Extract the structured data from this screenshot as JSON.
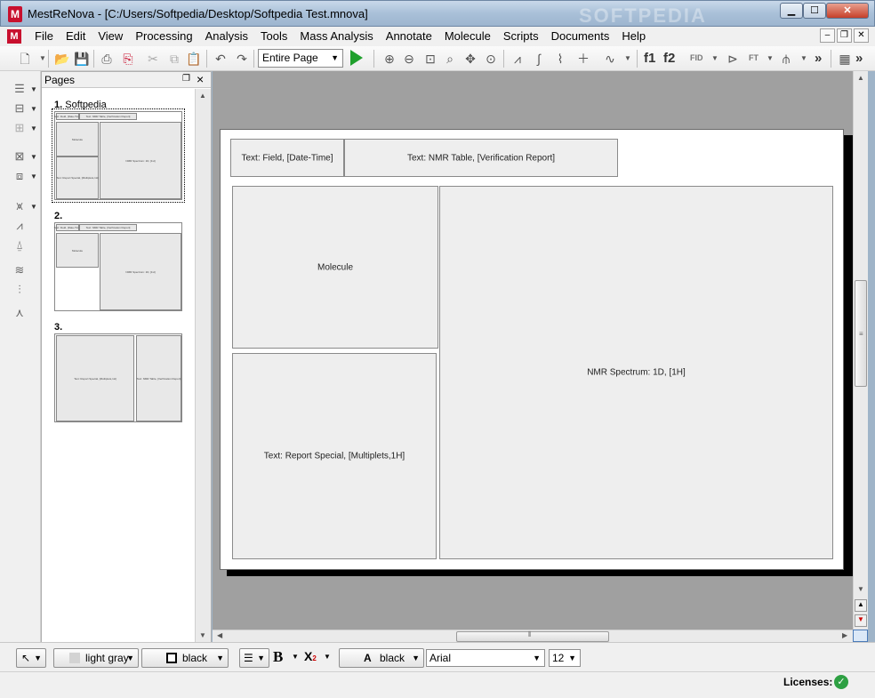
{
  "window": {
    "app_name": "MestReNova",
    "title": "MestReNova - [C:/Users/Softpedia/Desktop/Softpedia Test.mnova]",
    "watermark": "SOFTPEDIA"
  },
  "menu": {
    "items": [
      "File",
      "Edit",
      "View",
      "Processing",
      "Analysis",
      "Tools",
      "Mass Analysis",
      "Annotate",
      "Molecule",
      "Scripts",
      "Documents",
      "Help"
    ]
  },
  "toolbar": {
    "page_view_value": "Entire Page",
    "f1_label": "f1",
    "f2_label": "f2",
    "fid_label": "FID",
    "ft_label": "FT",
    "overflow_label": "»"
  },
  "pages_panel": {
    "header": "Pages",
    "pages": [
      {
        "number": "1.",
        "name": "Softpedia"
      },
      {
        "number": "2.",
        "name": ""
      },
      {
        "number": "3.",
        "name": ""
      }
    ]
  },
  "document": {
    "frames": {
      "datetime": "Text: Field, [Date-Time]",
      "nmr_table": "Text: NMR Table, [Verification Report]",
      "molecule": "Molecule",
      "report_special": "Text: Report Special, [Multiplets,1H]",
      "nmr_spectrum": "NMR Spectrum: 1D, [1H]"
    }
  },
  "format_bar": {
    "fill_color": "light gray",
    "line_color": "black",
    "bold_label": "B",
    "subscript_label": "X",
    "subscript_index": "2",
    "font_color_glyph": "A",
    "font_color": "black",
    "font_family": "Arial",
    "font_size": "12"
  },
  "status": {
    "licenses_label": "Licenses:"
  },
  "colors": {
    "accent": "#c8102e",
    "play_green": "#1fa02c",
    "status_ok": "#2ea043",
    "frame_fill": "#eeeeee"
  }
}
